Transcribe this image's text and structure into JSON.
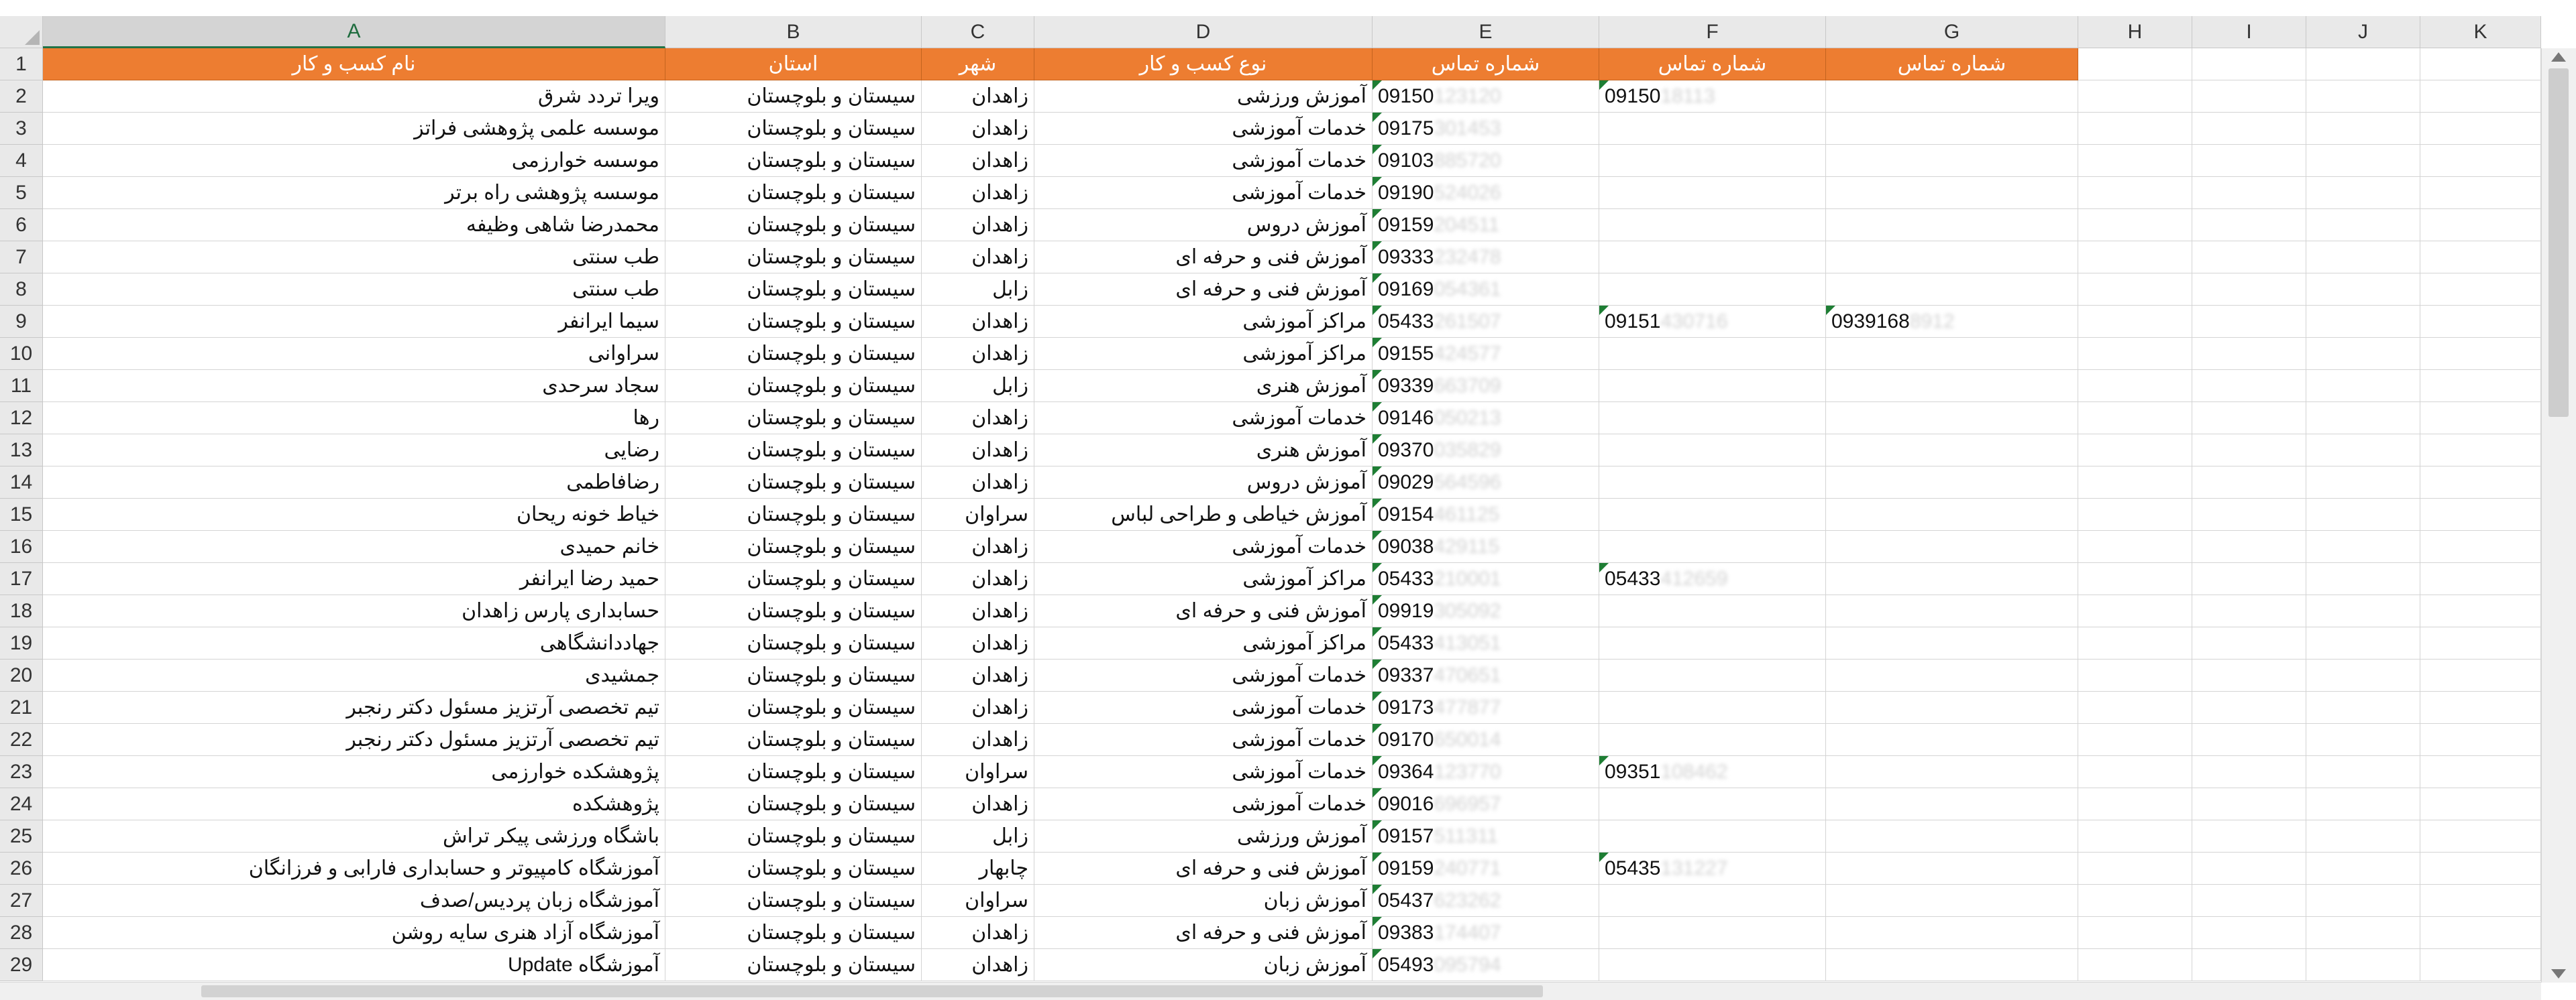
{
  "columns": [
    "A",
    "B",
    "C",
    "D",
    "E",
    "F",
    "G",
    "H",
    "I",
    "J",
    "K"
  ],
  "selected_column": "A",
  "header_row": {
    "number": "1",
    "A": "نام کسب و کار",
    "B": "استان",
    "C": "شهر",
    "D": "نوع کسب و کار",
    "E": "شماره تماس",
    "F": "شماره تماس",
    "G": "شماره تماس"
  },
  "colors": {
    "header_fill": "#ed7d31",
    "header_text": "#ffffff",
    "selected_column_accent": "#217346",
    "number_flag": "#1e7e34"
  },
  "rows": [
    {
      "n": "2",
      "A": "ویرا تردد شرق",
      "B": "سیستان و بلوچستان",
      "C": "زاهدان",
      "D": "آموزش ورزشی",
      "E": "09150",
      "E_hidden": "123120",
      "F": "09150",
      "F_hidden": "18113"
    },
    {
      "n": "3",
      "A": "موسسه علمی پژوهشی فراتز",
      "B": "سیستان و بلوچستان",
      "C": "زاهدان",
      "D": "خدمات آموزشی",
      "E": "09175",
      "E_hidden": "301453"
    },
    {
      "n": "4",
      "A": "موسسه خوارزمی",
      "B": "سیستان و بلوچستان",
      "C": "زاهدان",
      "D": "خدمات آموزشی",
      "E": "09103",
      "E_hidden": "885720"
    },
    {
      "n": "5",
      "A": "موسسه پژوهشی راه برتر",
      "B": "سیستان و بلوچستان",
      "C": "زاهدان",
      "D": "خدمات آموزشی",
      "E": "09190",
      "E_hidden": "524026"
    },
    {
      "n": "6",
      "A": "محمدرضا شاهی وظیفه",
      "B": "سیستان و بلوچستان",
      "C": "زاهدان",
      "D": "آموزش دروس",
      "E": "09159",
      "E_hidden": "204511"
    },
    {
      "n": "7",
      "A": "طب سنتی",
      "B": "سیستان و بلوچستان",
      "C": "زاهدان",
      "D": "آموزش فنی و حرفه ای",
      "E": "09333",
      "E_hidden": "232478"
    },
    {
      "n": "8",
      "A": "طب سنتی",
      "B": "سیستان و بلوچستان",
      "C": "زابل",
      "D": "آموزش فنی و حرفه ای",
      "E": "09169",
      "E_hidden": "054361"
    },
    {
      "n": "9",
      "A": "سیما ایرانفر",
      "B": "سیستان و بلوچستان",
      "C": "زاهدان",
      "D": "مراکز آموزشی",
      "E": "05433",
      "E_hidden": "261507",
      "F": "09151",
      "F_hidden": "430716",
      "G": "0939168",
      "G_hidden": "8912"
    },
    {
      "n": "10",
      "A": "سراوانی",
      "B": "سیستان و بلوچستان",
      "C": "زاهدان",
      "D": "مراکز آموزشی",
      "E": "09155",
      "E_hidden": "424577"
    },
    {
      "n": "11",
      "A": "سجاد سرحدی",
      "B": "سیستان و بلوچستان",
      "C": "زابل",
      "D": "آموزش هنری",
      "E": "09339",
      "E_hidden": "663709"
    },
    {
      "n": "12",
      "A": "رها",
      "B": "سیستان و بلوچستان",
      "C": "زاهدان",
      "D": "خدمات آموزشی",
      "E": "09146",
      "E_hidden": "050213"
    },
    {
      "n": "13",
      "A": "رضایی",
      "B": "سیستان و بلوچستان",
      "C": "زاهدان",
      "D": "آموزش هنری",
      "E": "09370",
      "E_hidden": "035829"
    },
    {
      "n": "14",
      "A": "رضافاطمی",
      "B": "سیستان و بلوچستان",
      "C": "زاهدان",
      "D": "آموزش دروس",
      "E": "09029",
      "E_hidden": "564596"
    },
    {
      "n": "15",
      "A": "خیاط خونه ریحان",
      "B": "سیستان و بلوچستان",
      "C": "سراوان",
      "D": "آموزش خیاطی و طراحی لباس",
      "E": "09154",
      "E_hidden": "461125"
    },
    {
      "n": "16",
      "A": "خانم حمیدی",
      "B": "سیستان و بلوچستان",
      "C": "زاهدان",
      "D": "خدمات آموزشی",
      "E": "09038",
      "E_hidden": "429115"
    },
    {
      "n": "17",
      "A": "حمید رضا ایرانفر",
      "B": "سیستان و بلوچستان",
      "C": "زاهدان",
      "D": "مراکز آموزشی",
      "E": "05433",
      "E_hidden": "210001",
      "F": "05433",
      "F_hidden": "412659"
    },
    {
      "n": "18",
      "A": "حسابداری پارس زاهدان",
      "B": "سیستان و بلوچستان",
      "C": "زاهدان",
      "D": "آموزش فنی و حرفه ای",
      "E": "09919",
      "E_hidden": "305092"
    },
    {
      "n": "19",
      "A": "جهاددانشگاهی",
      "B": "سیستان و بلوچستان",
      "C": "زاهدان",
      "D": "مراکز آموزشی",
      "E": "05433",
      "E_hidden": "413051"
    },
    {
      "n": "20",
      "A": "جمشیدی",
      "B": "سیستان و بلوچستان",
      "C": "زاهدان",
      "D": "خدمات آموزشی",
      "E": "09337",
      "E_hidden": "470651"
    },
    {
      "n": "21",
      "A": "تیم تخصصی آرتزیز مسئول دکتر رنجبر",
      "B": "سیستان و بلوچستان",
      "C": "زاهدان",
      "D": "خدمات آموزشی",
      "E": "09173",
      "E_hidden": "477877"
    },
    {
      "n": "22",
      "A": "تیم تخصصی آرتزیز مسئول دکتر رنجبر",
      "B": "سیستان و بلوچستان",
      "C": "زاهدان",
      "D": "خدمات آموزشی",
      "E": "09170",
      "E_hidden": "650014"
    },
    {
      "n": "23",
      "A": "پژوهشکده خوارزمی",
      "B": "سیستان و بلوچستان",
      "C": "سراوان",
      "D": "خدمات آموزشی",
      "E": "09364",
      "E_hidden": "123770",
      "F": "09351",
      "F_hidden": "108462"
    },
    {
      "n": "24",
      "A": "پژوهشکده",
      "B": "سیستان و بلوچستان",
      "C": "زاهدان",
      "D": "خدمات آموزشی",
      "E": "09016",
      "E_hidden": "696957"
    },
    {
      "n": "25",
      "A": "باشگاه ورزشی پیکر تراش",
      "B": "سیستان و بلوچستان",
      "C": "زابل",
      "D": "آموزش ورزشی",
      "E": "09157",
      "E_hidden": "511311"
    },
    {
      "n": "26",
      "A": "آموزشگاه کامپیوتر و حسابداری فارابی و فرزانگان",
      "B": "سیستان و بلوچستان",
      "C": "چابهار",
      "D": "آموزش فنی و حرفه ای",
      "E": "09159",
      "E_hidden": "240771",
      "F": "05435",
      "F_hidden": "131227"
    },
    {
      "n": "27",
      "A": "آموزشگاه زبان پردیس/صدف",
      "B": "سیستان و بلوچستان",
      "C": "سراوان",
      "D": "آموزش زبان",
      "E": "05437",
      "E_hidden": "623262"
    },
    {
      "n": "28",
      "A": "آموزشگاه آزاد هنری سایه روشن",
      "B": "سیستان و بلوچستان",
      "C": "زاهدان",
      "D": "آموزش فنی و حرفه ای",
      "E": "09383",
      "E_hidden": "174407"
    },
    {
      "n": "29",
      "A": "آموزشگاه Update",
      "B": "سیستان و بلوچستان",
      "C": "زاهدان",
      "D": "آموزش زبان",
      "E": "05493",
      "E_hidden": "095794"
    }
  ]
}
